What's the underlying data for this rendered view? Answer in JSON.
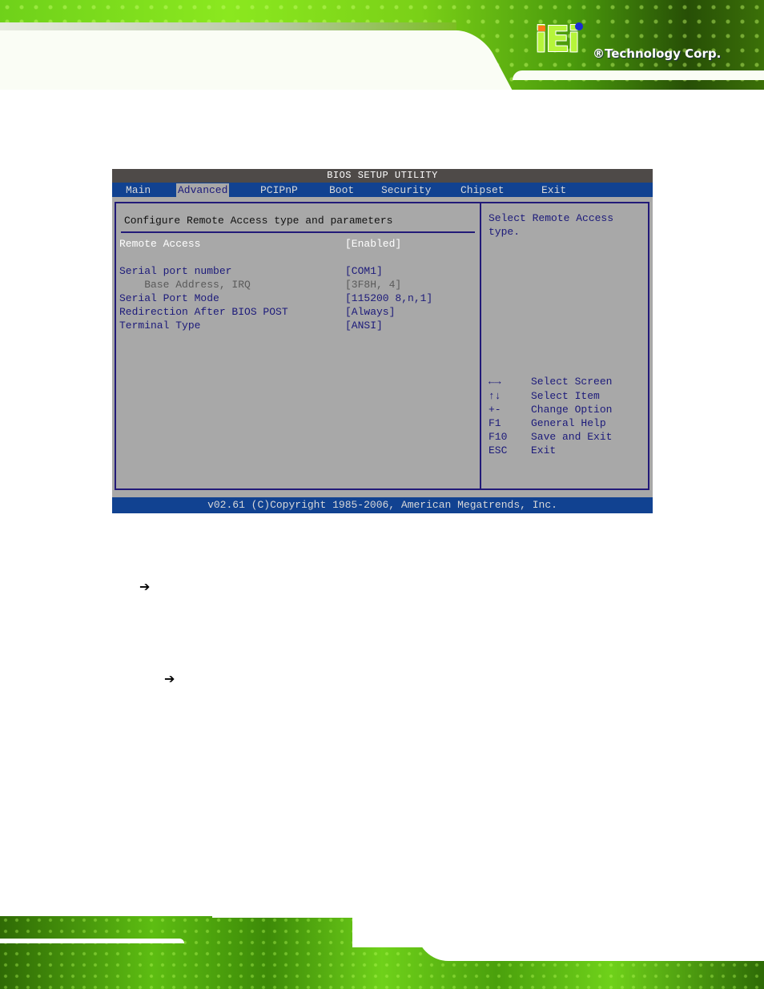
{
  "header": {
    "logo_text": "iEi",
    "company": "®Technology Corp."
  },
  "bios": {
    "title": "BIOS SETUP UTILITY",
    "tabs": [
      {
        "label": "Main",
        "active": false
      },
      {
        "label": "Advanced",
        "active": true
      },
      {
        "label": "PCIPnP",
        "active": false
      },
      {
        "label": "Boot",
        "active": false
      },
      {
        "label": "Security",
        "active": false
      },
      {
        "label": "Chipset",
        "active": false
      },
      {
        "label": "Exit",
        "active": false
      }
    ],
    "section_title": "Configure Remote Access type and parameters",
    "settings": [
      {
        "label": "Remote Access",
        "value": "[Enabled]",
        "state": "highlighted"
      },
      {
        "label": "Serial port number",
        "value": "[COM1]",
        "state": "normal"
      },
      {
        "label": "    Base Address, IRQ",
        "value": "[3F8H, 4]",
        "state": "disabled"
      },
      {
        "label": "Serial Port Mode",
        "value": "[115200 8,n,1]",
        "state": "normal"
      },
      {
        "label": "Redirection After BIOS POST",
        "value": "[Always]",
        "state": "normal"
      },
      {
        "label": "Terminal Type",
        "value": "[ANSI]",
        "state": "normal"
      }
    ],
    "help_lines": [
      "Select Remote Access",
      "type."
    ],
    "keys": [
      {
        "key": "←→",
        "desc": "Select Screen"
      },
      {
        "key": "↑↓",
        "desc": "Select Item"
      },
      {
        "key": "+-",
        "desc": "Change Option"
      },
      {
        "key": "F1",
        "desc": "General Help"
      },
      {
        "key": "F10",
        "desc": "Save and Exit"
      },
      {
        "key": "ESC",
        "desc": "Exit"
      }
    ],
    "footer": "v02.61 (C)Copyright 1985-2006, American Megatrends, Inc."
  },
  "body": {
    "arrow_glyph": "➔"
  },
  "colors": {
    "bios_bg": "#a8a8a8",
    "bios_blue": "#114291",
    "bios_text": "#1c1a7a",
    "bios_title_bar": "#4e4a48"
  }
}
